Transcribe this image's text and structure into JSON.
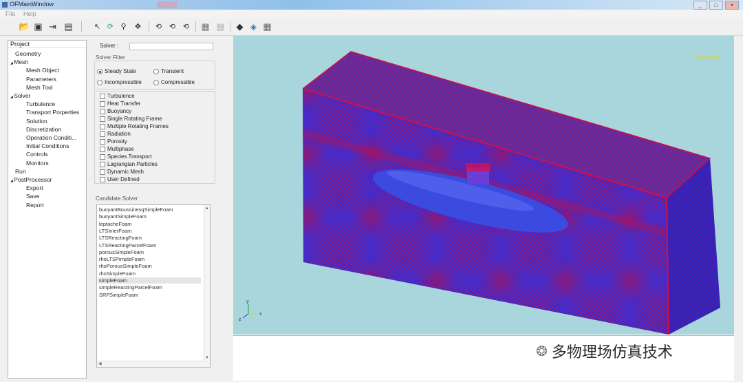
{
  "window": {
    "title": "OFMainWindow"
  },
  "menu": [
    "File",
    "Help"
  ],
  "toolbar": {
    "icons": [
      "open-icon",
      "save-icon",
      "import-icon",
      "export-icon",
      "select-icon",
      "rotate-icon",
      "zoom-icon",
      "pan-icon",
      "view-front-icon",
      "view-side-icon",
      "view-top-icon",
      "grid-icon",
      "grid-dim-icon",
      "render-icon",
      "mesh-display-icon",
      "wireframe-icon"
    ]
  },
  "project": {
    "header": "Project",
    "items": [
      {
        "label": "Geometry",
        "level": 1
      },
      {
        "label": "Mesh",
        "level": 0,
        "expanded": true
      },
      {
        "label": "Mesh Object",
        "level": 2
      },
      {
        "label": "Parameters",
        "level": 2
      },
      {
        "label": "Mesh Tool",
        "level": 2
      },
      {
        "label": "Solver",
        "level": 0,
        "expanded": true
      },
      {
        "label": "Turbulence",
        "level": 2
      },
      {
        "label": "Transport Porperties",
        "level": 2
      },
      {
        "label": "Solution",
        "level": 2
      },
      {
        "label": "Discretization",
        "level": 2
      },
      {
        "label": "Operation Conditi...",
        "level": 2
      },
      {
        "label": "Initial Conditions",
        "level": 2
      },
      {
        "label": "Controls",
        "level": 2
      },
      {
        "label": "Monitors",
        "level": 2
      },
      {
        "label": "Run",
        "level": 1
      },
      {
        "label": "PostProcessor",
        "level": 0,
        "expanded": true
      },
      {
        "label": "Export",
        "level": 2
      },
      {
        "label": "Save",
        "level": 2
      },
      {
        "label": "Report",
        "level": 2
      }
    ]
  },
  "solver": {
    "label": "Solver :",
    "value": "",
    "filter_title": "Solver Filter",
    "radios": [
      {
        "label": "Steady State",
        "checked": true
      },
      {
        "label": "Transient",
        "checked": false
      },
      {
        "label": "Incompressible",
        "checked": false
      },
      {
        "label": "Compressible",
        "checked": false
      }
    ],
    "checkboxes": [
      "Turbulence",
      "Heat Transfer",
      "Buoyancy",
      "Single Rotating Frame",
      "Multiple Rotating Frames",
      "Radiation",
      "Porosity",
      "Multiphase",
      "Species Transport",
      "Lagrangian Particles",
      "Dynamic Mesh",
      "User Defined"
    ],
    "candidate_title": "Candidate Solver",
    "candidates": [
      "buoyantBoussinesqSimpleFoam",
      "buoyantSimpleFoam",
      "leptacheFoam",
      "LTSInterFoam",
      "LTSReactingFoam",
      "LTSReactingParcelFoam",
      "porousSimpleFoam",
      "rhoLTSPimpleFoam",
      "rhoPorousSimpleFoam",
      "rhoSimpleFoam",
      "simpleFoam",
      "simpleReactingParcelFoam",
      "SRFSimpleFoam"
    ],
    "selected_candidate": "simpleFoam"
  },
  "viewport": {
    "corner_label": "Ready/Done"
  },
  "watermark": {
    "text": "多物理场仿真技术"
  },
  "colors": {
    "viewport_bg": "#a9d6dc",
    "mesh_blue": "#3a2bd0",
    "mesh_red": "#c0124a"
  }
}
